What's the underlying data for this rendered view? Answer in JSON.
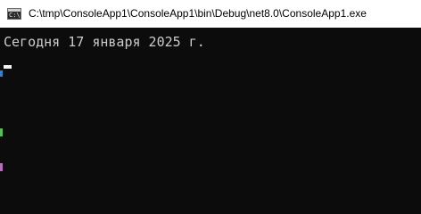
{
  "window": {
    "title": "C:\\tmp\\ConsoleApp1\\ConsoleApp1\\bin\\Debug\\net8.0\\ConsoleApp1.exe",
    "icon": "console-app-icon",
    "icon_prompt": "C:\\"
  },
  "console": {
    "lines": [
      "Сегодня 17 января 2025 г."
    ]
  },
  "colors": {
    "console_background": "#0c0c0c",
    "console_text": "#cccccc",
    "titlebar_background": "#ffffff"
  }
}
